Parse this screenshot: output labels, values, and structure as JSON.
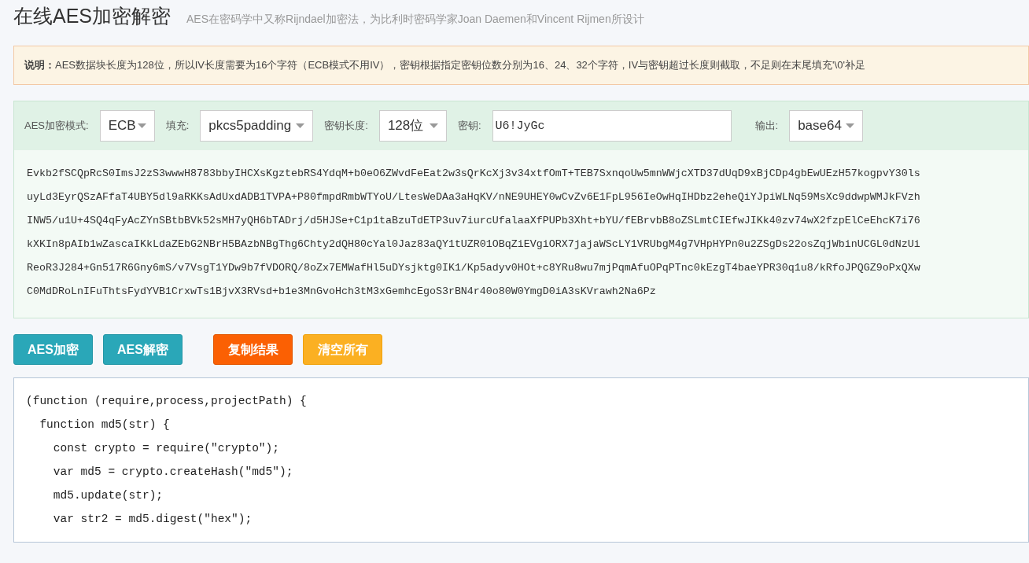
{
  "header": {
    "title": "在线AES加密解密",
    "subtitle": "AES在密码学中又称Rijndael加密法，为比利时密码学家Joan Daemen和Vincent Rijmen所设计"
  },
  "notice": "**说明：**AES数据块长度为128位，所以IV长度需要为16个字符（ECB模式不用IV），密钥根据指定密钥位数分别为16、24、32个字符，IV与密钥超过长度则截取，不足则在末尾填充'\\0'补足",
  "settings": [
    {
      "kind": "select",
      "label": "AES加密模式:",
      "value": "ECB"
    },
    {
      "kind": "select",
      "label": "填充:",
      "value": "pkcs5padding"
    },
    {
      "kind": "select",
      "label": "密钥长度:",
      "value": "128位"
    },
    {
      "kind": "input",
      "label": "密钥:",
      "value": "U6!JyGc"
    },
    {
      "kind": "select",
      "label": "输出:",
      "value": "base64"
    }
  ],
  "output_lines": [
    "Evkb2fSCQpRcS0ImsJ2zS3wwwH8783bbyIHCXsKgztebRS4YdqM+b0eO6ZWvdFeEat2w3sQrKcXj3v34xtfOmT+TEB7SxnqoUw5mnWWjcXTD37dUqD9xBjCDp4gbEwUEzH57kogpvY30ls",
    "uyLd3EyrQSzAFfaT4UBY5dl9aRKKsAdUxdADB1TVPA+P80fmpdRmbWTYoU/LtesWeDAa3aHqKV/nNE9UHEY0wCvZv6E1FpL956IeOwHqIHDbz2eheQiYJpiWLNq59MsXc9ddwpWMJkFVzh",
    "INW5/u1U+4SQ4qFyAcZYnSBtbBVk52sMH7yQH6bTADrj/d5HJSe+C1p1taBzuTdETP3uv7iurcUfalaaXfPUPb3Xht+bYU/fEBrvbB8oZSLmtCIEfwJIKk40zv74wX2fzpElCeEhcK7i76",
    "kXKIn8pAIb1wZascaIKkLdaZEbG2NBrH5BAzbNBgThg6Chty2dQH80cYal0Jaz83aQY1tUZR01OBqZiEVgiORX7jajaWScLY1VRUbgM4g7VHpHYPn0u2ZSgDs22osZqjWbinUCGL0dNzUi",
    "ReoR3J284+Gn517R6Gny6mS/v7VsgT1YDw9b7fVDORQ/8oZx7EMWafHl5uDYsjktg0IK1/Kp5adyv0HOt+c8YRu8wu7mjPqmAfuOPqPTnc0kEzgT4baeYPR30q1u8/kRfoJPQGZ9oPxQXw",
    "C0MdDRoLnIFuThtsFydYVB1CrxwTs1BjvX3RVsd+b1e3MnGvoHch3tM3xGemhcEgoS3rBN4r40o80W0YmgD0iA3sKVrawh2Na6Pz"
  ],
  "buttons": [
    {
      "kind": "primary",
      "label": "AES加密"
    },
    {
      "kind": "primary",
      "label": "AES解密"
    },
    {
      "kind": "danger",
      "label": "复制结果"
    },
    {
      "kind": "warning",
      "label": "清空所有"
    }
  ],
  "code_lines": [
    "(function (require,process,projectPath) {",
    "  function md5(str) {",
    "    const crypto = require(\"crypto\");",
    "    var md5 = crypto.createHash(\"md5\");",
    "    md5.update(str);",
    "    var str2 = md5.digest(\"hex\");"
  ]
}
